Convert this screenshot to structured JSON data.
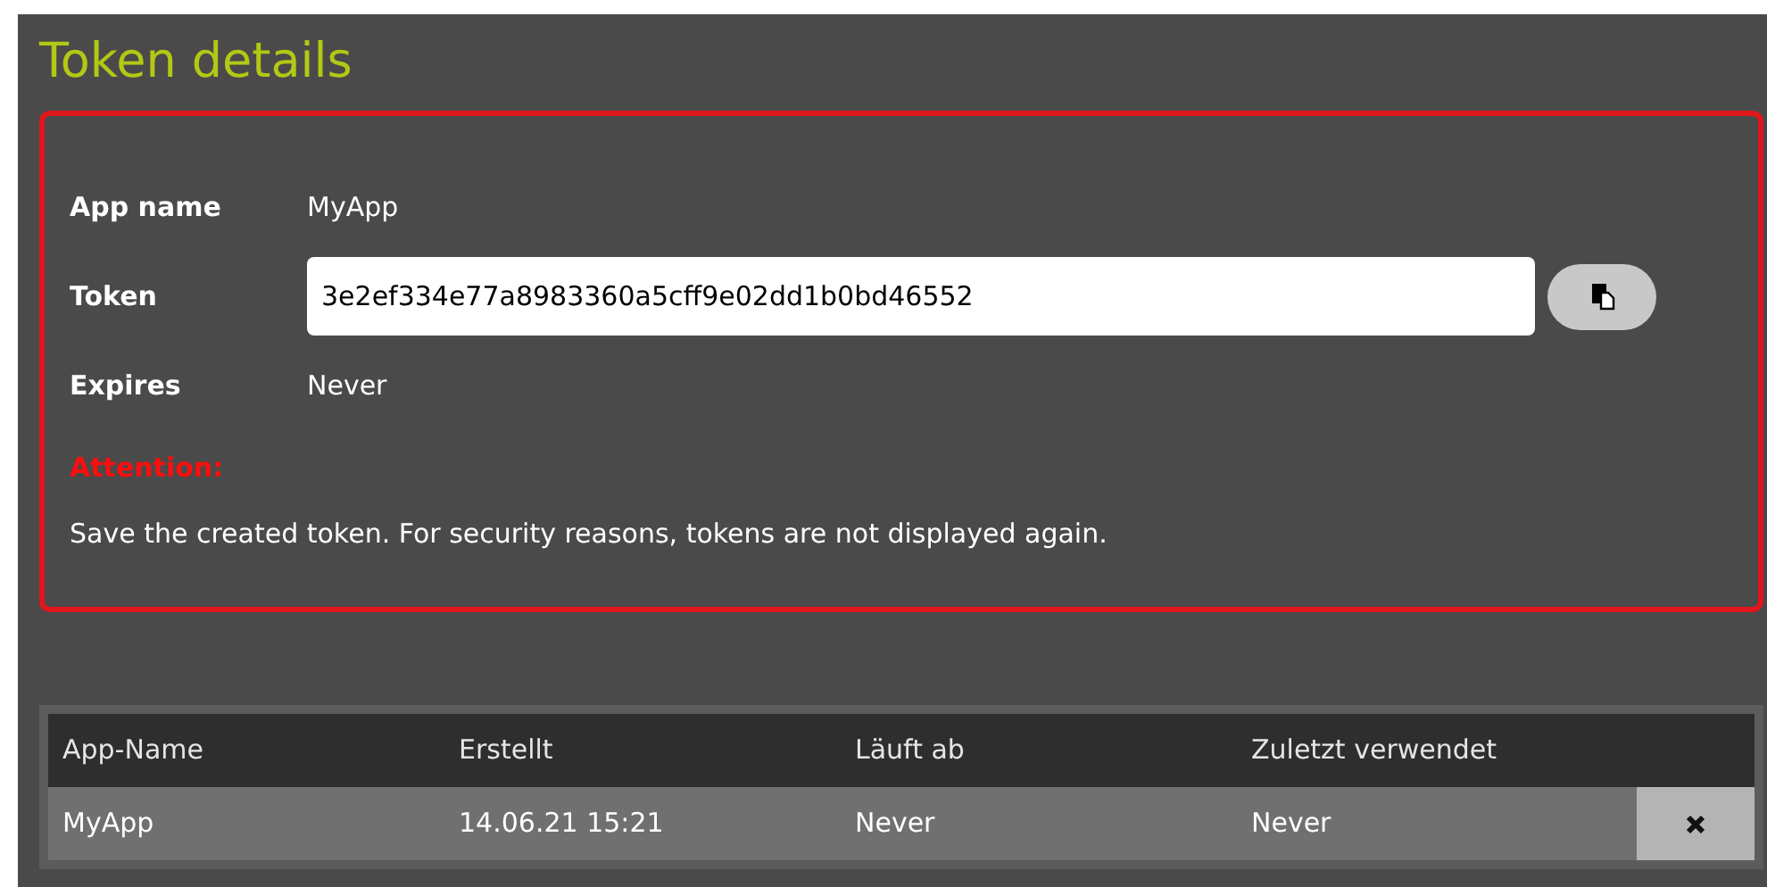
{
  "title": "Token details",
  "details": {
    "fields": [
      {
        "label": "App name",
        "kind": "text",
        "value": "MyApp"
      },
      {
        "label": "Token",
        "kind": "input",
        "value": "3e2ef334e77a8983360a5cff9e02dd1b0bd46552"
      },
      {
        "label": "Expires",
        "kind": "text",
        "value": "Never"
      }
    ],
    "attention_label": "Attention:",
    "attention_text": "Save the created token. For security reasons, tokens are not displayed again."
  },
  "table": {
    "columns": [
      "App-Name",
      "Erstellt",
      "Läuft ab",
      "Zuletzt verwendet"
    ],
    "rows": [
      {
        "cells": [
          "MyApp",
          "14.06.21 15:21",
          "Never",
          "Never"
        ]
      }
    ]
  }
}
